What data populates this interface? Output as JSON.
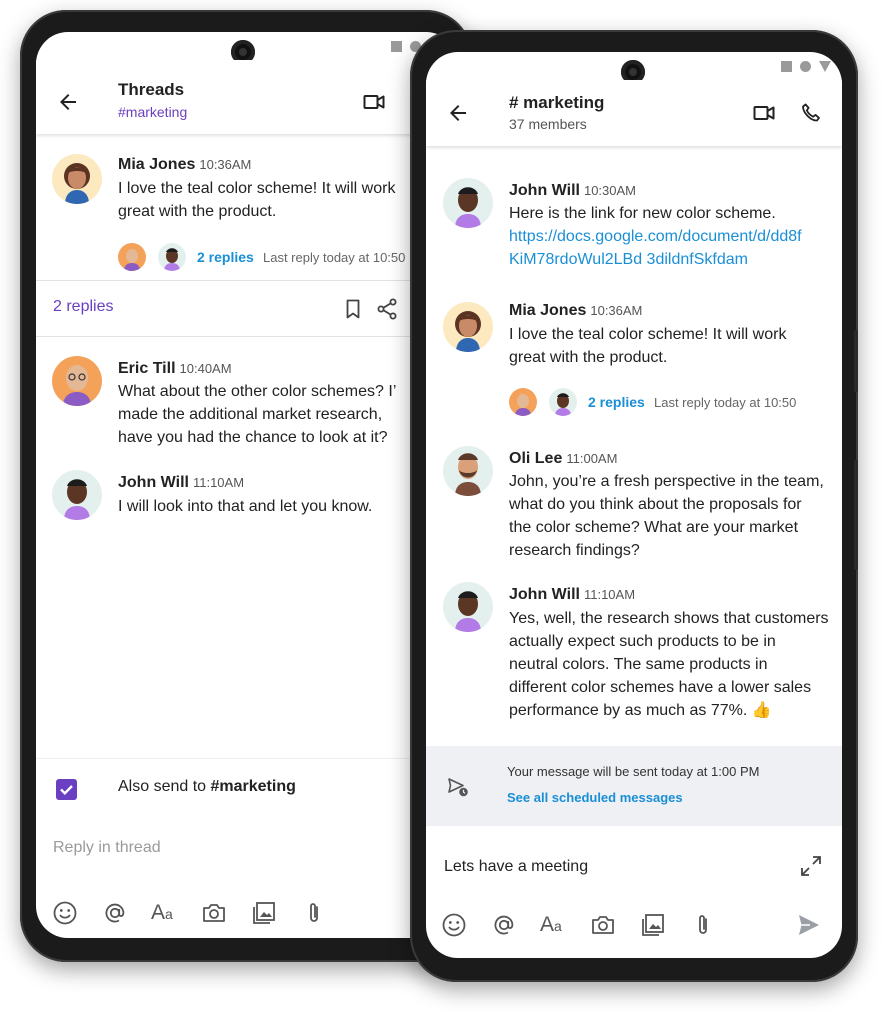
{
  "left": {
    "header": {
      "title": "Threads",
      "channel": "#marketing"
    },
    "root_message": {
      "author": "Mia Jones",
      "time": "10:36AM",
      "text": "I love the teal color scheme! It will work great with the product.",
      "replies_label": "2 replies",
      "last_reply": "Last reply today at 10:50"
    },
    "thread_bar": {
      "replies_count": "2 replies"
    },
    "replies": [
      {
        "author": "Eric Till",
        "time": "10:40AM",
        "text": "What about the other color schemes? I’ made the additional market research, have you had the chance to look at it?"
      },
      {
        "author": "John Will",
        "time": "11:10AM",
        "text": "I will look into that and let you know."
      }
    ],
    "also_send": {
      "prefix": "Also send to ",
      "channel": "#marketing",
      "checked": true
    },
    "composer": {
      "placeholder": "Reply in thread"
    }
  },
  "right": {
    "header": {
      "title": "# marketing",
      "members": "37 members"
    },
    "messages": [
      {
        "author": "John Will",
        "time": "10:30AM",
        "text": "Here is the link for new color scheme.",
        "link": "https://docs.google.com/document/d/dd8fKiM78rdoWul2LBd 3dildnfSkfdam"
      },
      {
        "author": "Mia Jones",
        "time": "10:36AM",
        "text": "I love the teal color scheme! It will work great with the product.",
        "replies_label": "2 replies",
        "last_reply": "Last reply today at 10:50"
      },
      {
        "author": "Oli Lee",
        "time": "11:00AM",
        "text": "John, you’re a fresh perspective in the team, what do you think about the proposals for the color scheme? What are your market research findings?"
      },
      {
        "author": "John Will",
        "time": "11:10AM",
        "text": "Yes, well, the research shows that customers actually expect such products to be in neutral colors. The same products in different color schemes have a lower sales performance by as much as 77%. 👍"
      }
    ],
    "scheduled": {
      "text": "Your message will be sent today at 1:00 PM",
      "link": "See all scheduled messages"
    },
    "composer": {
      "value": "Lets have a meeting"
    }
  },
  "colors": {
    "accent_purple": "#6a3fc1",
    "link_blue": "#1a8fd6",
    "scheduled_bg": "#eef0f4"
  }
}
